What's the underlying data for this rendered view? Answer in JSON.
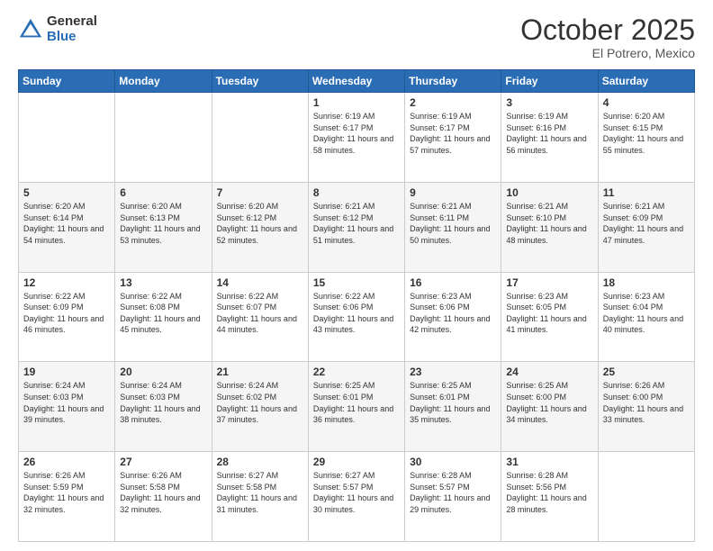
{
  "logo": {
    "general": "General",
    "blue": "Blue"
  },
  "header": {
    "month": "October 2025",
    "location": "El Potrero, Mexico"
  },
  "weekdays": [
    "Sunday",
    "Monday",
    "Tuesday",
    "Wednesday",
    "Thursday",
    "Friday",
    "Saturday"
  ],
  "weeks": [
    [
      {
        "day": "",
        "info": ""
      },
      {
        "day": "",
        "info": ""
      },
      {
        "day": "",
        "info": ""
      },
      {
        "day": "1",
        "info": "Sunrise: 6:19 AM\nSunset: 6:17 PM\nDaylight: 11 hours\nand 58 minutes."
      },
      {
        "day": "2",
        "info": "Sunrise: 6:19 AM\nSunset: 6:17 PM\nDaylight: 11 hours\nand 57 minutes."
      },
      {
        "day": "3",
        "info": "Sunrise: 6:19 AM\nSunset: 6:16 PM\nDaylight: 11 hours\nand 56 minutes."
      },
      {
        "day": "4",
        "info": "Sunrise: 6:20 AM\nSunset: 6:15 PM\nDaylight: 11 hours\nand 55 minutes."
      }
    ],
    [
      {
        "day": "5",
        "info": "Sunrise: 6:20 AM\nSunset: 6:14 PM\nDaylight: 11 hours\nand 54 minutes."
      },
      {
        "day": "6",
        "info": "Sunrise: 6:20 AM\nSunset: 6:13 PM\nDaylight: 11 hours\nand 53 minutes."
      },
      {
        "day": "7",
        "info": "Sunrise: 6:20 AM\nSunset: 6:12 PM\nDaylight: 11 hours\nand 52 minutes."
      },
      {
        "day": "8",
        "info": "Sunrise: 6:21 AM\nSunset: 6:12 PM\nDaylight: 11 hours\nand 51 minutes."
      },
      {
        "day": "9",
        "info": "Sunrise: 6:21 AM\nSunset: 6:11 PM\nDaylight: 11 hours\nand 50 minutes."
      },
      {
        "day": "10",
        "info": "Sunrise: 6:21 AM\nSunset: 6:10 PM\nDaylight: 11 hours\nand 48 minutes."
      },
      {
        "day": "11",
        "info": "Sunrise: 6:21 AM\nSunset: 6:09 PM\nDaylight: 11 hours\nand 47 minutes."
      }
    ],
    [
      {
        "day": "12",
        "info": "Sunrise: 6:22 AM\nSunset: 6:09 PM\nDaylight: 11 hours\nand 46 minutes."
      },
      {
        "day": "13",
        "info": "Sunrise: 6:22 AM\nSunset: 6:08 PM\nDaylight: 11 hours\nand 45 minutes."
      },
      {
        "day": "14",
        "info": "Sunrise: 6:22 AM\nSunset: 6:07 PM\nDaylight: 11 hours\nand 44 minutes."
      },
      {
        "day": "15",
        "info": "Sunrise: 6:22 AM\nSunset: 6:06 PM\nDaylight: 11 hours\nand 43 minutes."
      },
      {
        "day": "16",
        "info": "Sunrise: 6:23 AM\nSunset: 6:06 PM\nDaylight: 11 hours\nand 42 minutes."
      },
      {
        "day": "17",
        "info": "Sunrise: 6:23 AM\nSunset: 6:05 PM\nDaylight: 11 hours\nand 41 minutes."
      },
      {
        "day": "18",
        "info": "Sunrise: 6:23 AM\nSunset: 6:04 PM\nDaylight: 11 hours\nand 40 minutes."
      }
    ],
    [
      {
        "day": "19",
        "info": "Sunrise: 6:24 AM\nSunset: 6:03 PM\nDaylight: 11 hours\nand 39 minutes."
      },
      {
        "day": "20",
        "info": "Sunrise: 6:24 AM\nSunset: 6:03 PM\nDaylight: 11 hours\nand 38 minutes."
      },
      {
        "day": "21",
        "info": "Sunrise: 6:24 AM\nSunset: 6:02 PM\nDaylight: 11 hours\nand 37 minutes."
      },
      {
        "day": "22",
        "info": "Sunrise: 6:25 AM\nSunset: 6:01 PM\nDaylight: 11 hours\nand 36 minutes."
      },
      {
        "day": "23",
        "info": "Sunrise: 6:25 AM\nSunset: 6:01 PM\nDaylight: 11 hours\nand 35 minutes."
      },
      {
        "day": "24",
        "info": "Sunrise: 6:25 AM\nSunset: 6:00 PM\nDaylight: 11 hours\nand 34 minutes."
      },
      {
        "day": "25",
        "info": "Sunrise: 6:26 AM\nSunset: 6:00 PM\nDaylight: 11 hours\nand 33 minutes."
      }
    ],
    [
      {
        "day": "26",
        "info": "Sunrise: 6:26 AM\nSunset: 5:59 PM\nDaylight: 11 hours\nand 32 minutes."
      },
      {
        "day": "27",
        "info": "Sunrise: 6:26 AM\nSunset: 5:58 PM\nDaylight: 11 hours\nand 32 minutes."
      },
      {
        "day": "28",
        "info": "Sunrise: 6:27 AM\nSunset: 5:58 PM\nDaylight: 11 hours\nand 31 minutes."
      },
      {
        "day": "29",
        "info": "Sunrise: 6:27 AM\nSunset: 5:57 PM\nDaylight: 11 hours\nand 30 minutes."
      },
      {
        "day": "30",
        "info": "Sunrise: 6:28 AM\nSunset: 5:57 PM\nDaylight: 11 hours\nand 29 minutes."
      },
      {
        "day": "31",
        "info": "Sunrise: 6:28 AM\nSunset: 5:56 PM\nDaylight: 11 hours\nand 28 minutes."
      },
      {
        "day": "",
        "info": ""
      }
    ]
  ]
}
